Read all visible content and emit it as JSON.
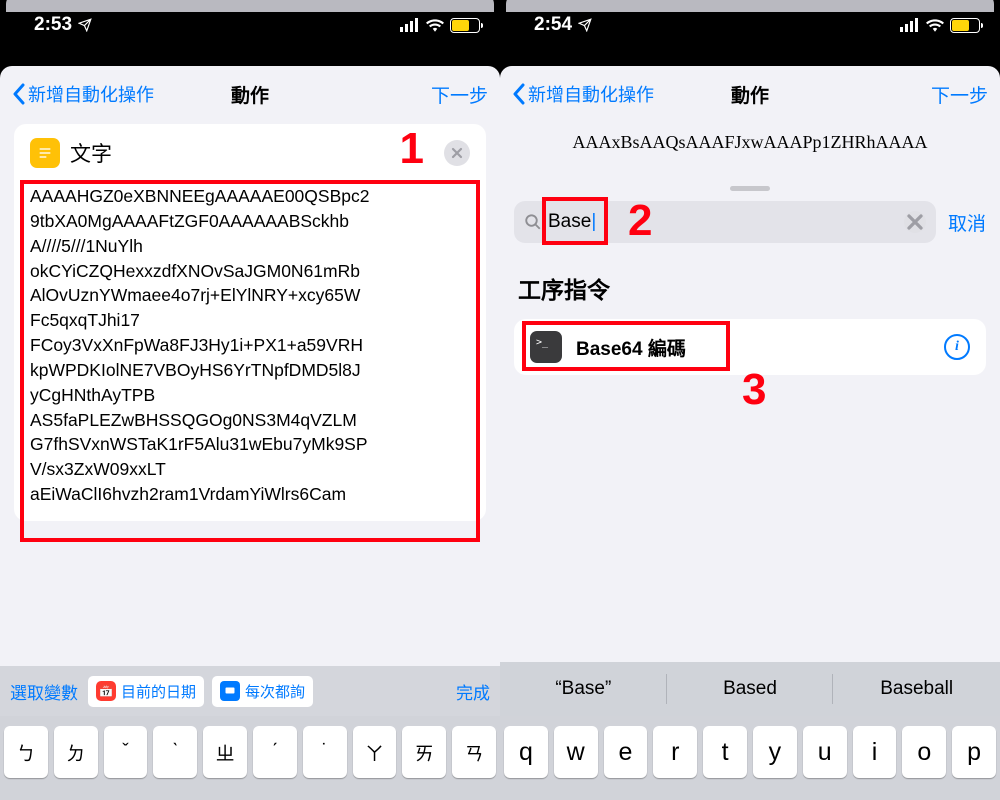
{
  "left": {
    "status_time": "2:53",
    "nav_back": "新增自動化操作",
    "nav_title": "動作",
    "nav_next": "下一步",
    "text_card_title": "文字",
    "text_body_lines": [
      "AAAAHGZ0eXBNNEEgAAAAAE00QSBpc2",
      "9tbXA0MgAAAAFtZGF0AAAAAABSckhb",
      "A////5///1NuYlh",
      "okCYiCZQHexxzdfXNOvSaJGM0N61mRb",
      "AlOvUznYWmaee4o7rj+ElYlNRY+xcy65W",
      "Fc5qxqTJhi17",
      "FCoy3VxXnFpWa8FJ3Hy1i+PX1+a59VRH",
      "kpWPDKIolNE7VBOyHS6YrTNpfDMD5l8J",
      "yCgHNthAyTPB",
      "AS5faPLEZwBHSSQGOg0NS3M4qVZLM",
      "G7fhSVxnWSTaK1rF5Alu31wEbu7yMk9SP",
      "V/sx3ZxW09xxLT",
      "aEiWaClI6hvzh2ram1VrdamYiWlrs6Cam"
    ],
    "select_var": "選取變數",
    "pill_date": "目前的日期",
    "pill_ask": "每次都詢",
    "done": "完成",
    "keys": [
      "ㄅ",
      "ㄉ",
      "ˇ",
      "ˋ",
      "ㄓ",
      "ˊ",
      "˙",
      "ㄚ",
      "ㄞ",
      "ㄢ"
    ],
    "annotation": "1"
  },
  "right": {
    "status_time": "2:54",
    "nav_back": "新增自動化操作",
    "nav_title": "動作",
    "nav_next": "下一步",
    "peek_text": "AAAxBsAAQsAAAFJxwAAAPp1ZHRhAAAA",
    "search_value": "Base",
    "cancel": "取消",
    "section_title": "工序指令",
    "result_label": "Base64 編碼",
    "predictions": [
      "“Base”",
      "Based",
      "Baseball"
    ],
    "keys": [
      "q",
      "w",
      "e",
      "r",
      "t",
      "y",
      "u",
      "i",
      "o",
      "p"
    ],
    "annotation2": "2",
    "annotation3": "3"
  }
}
